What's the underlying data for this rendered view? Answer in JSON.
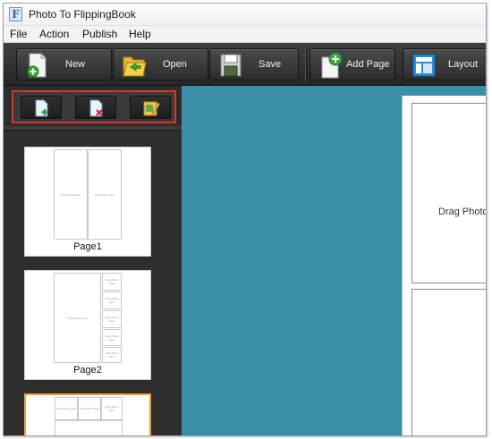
{
  "window": {
    "title": "Photo To FlippingBook",
    "app_icon_letter": "F"
  },
  "menu": [
    "File",
    "Action",
    "Publish",
    "Help"
  ],
  "toolbar": {
    "new": "New",
    "open": "Open",
    "save": "Save",
    "add_page": "Add Page",
    "layout": "Layout"
  },
  "page_panel": {
    "tools": [
      "add-page-icon",
      "delete-page-icon",
      "edit-page-icon"
    ],
    "highlight_color": "#d2362c",
    "pages": [
      {
        "label": "Page1",
        "placeholders": [
          "Drag Photo Here",
          "Drag Photo Here"
        ]
      },
      {
        "label": "Page2",
        "placeholders": [
          "Drag Photo Here",
          "Drag Photo Here",
          "Drag Photo Here",
          "Drag Photo Here",
          "Drag Photo Here",
          "Drag Photo Here"
        ]
      },
      {
        "label": "",
        "placeholders": [
          "Drag Photo Here",
          "Drag Photo Here",
          "Drag Photo Here"
        ]
      }
    ]
  },
  "workspace": {
    "background": "#3b90a8",
    "drop_text": "Drag Photo"
  }
}
